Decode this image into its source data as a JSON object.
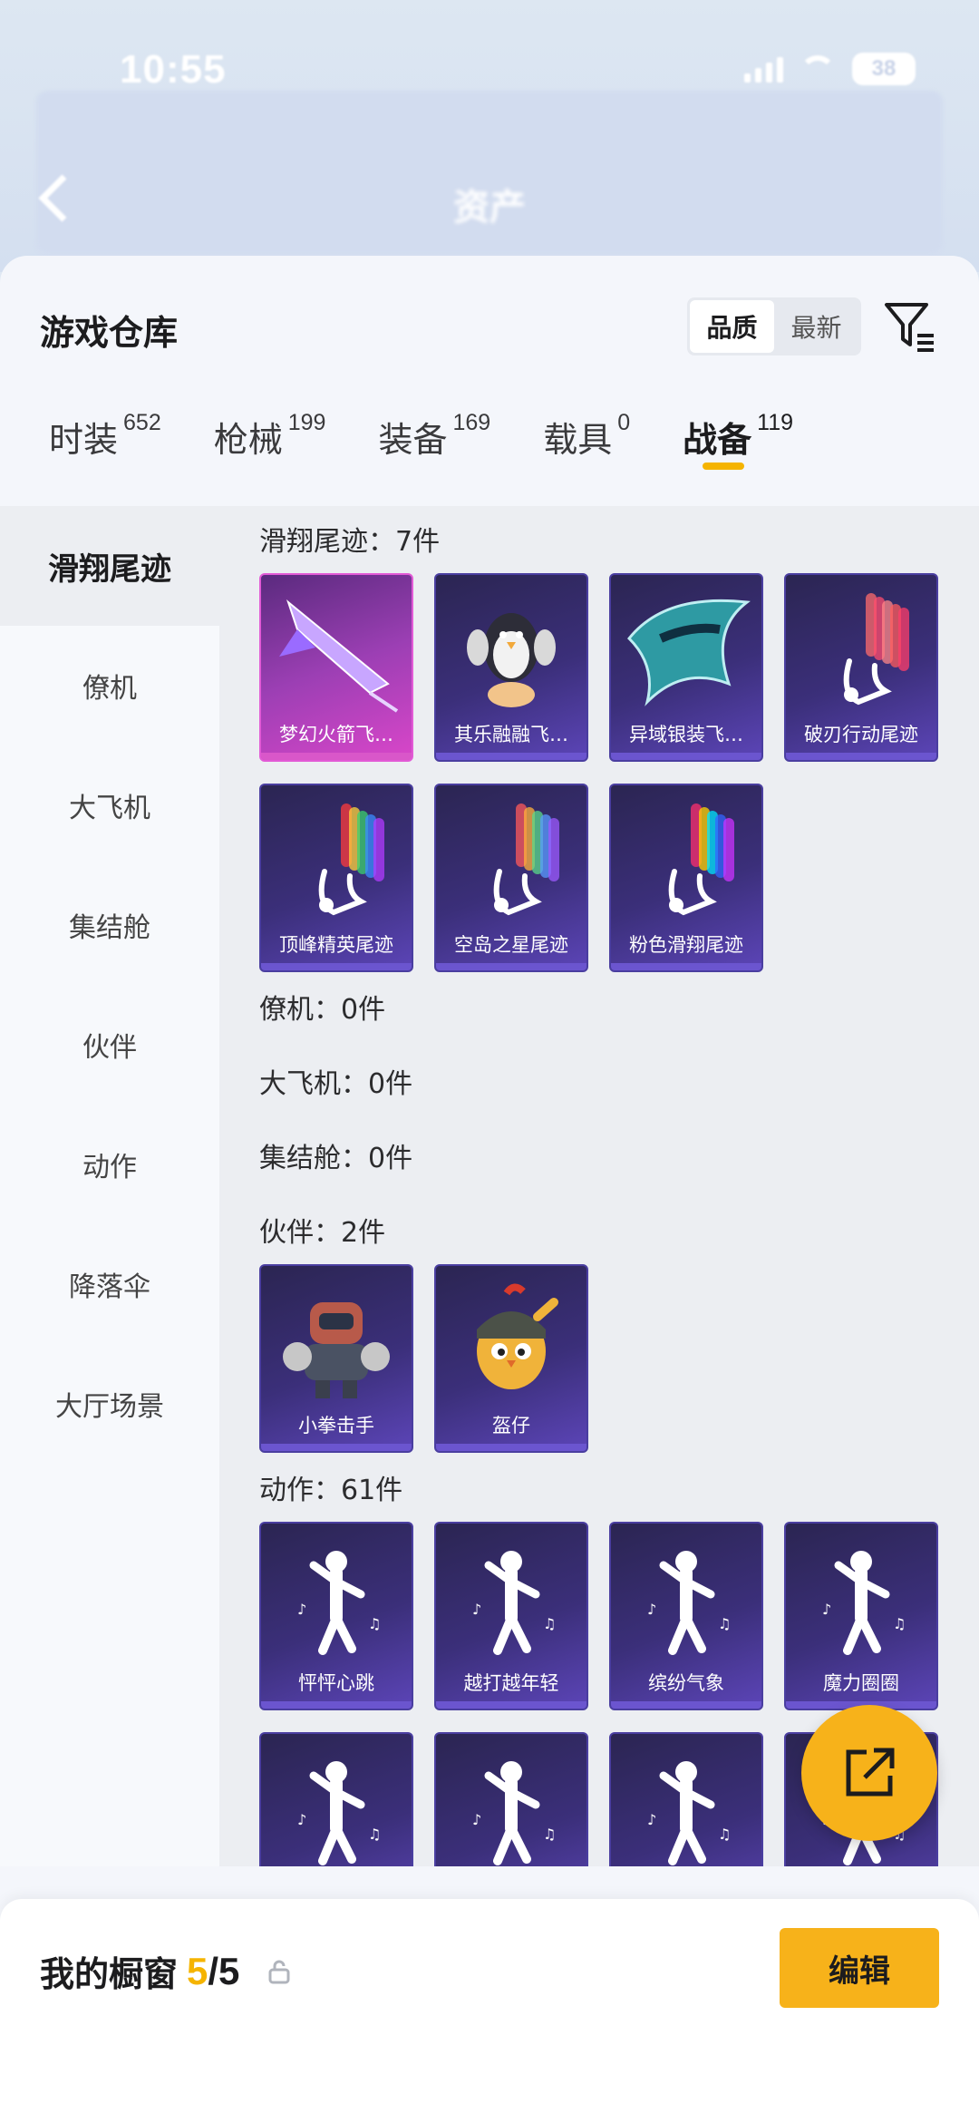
{
  "status_bar": {
    "time": "10:55",
    "battery": "38"
  },
  "app_bar": {
    "title": "资产"
  },
  "panel": {
    "title": "游戏仓库",
    "sort": {
      "options": [
        "品质",
        "最新"
      ],
      "selected": "品质"
    }
  },
  "tabs": [
    {
      "label": "时装",
      "count": "652"
    },
    {
      "label": "枪械",
      "count": "199"
    },
    {
      "label": "装备",
      "count": "169"
    },
    {
      "label": "载具",
      "count": "0"
    },
    {
      "label": "战备",
      "count": "119",
      "active": true
    }
  ],
  "categories": [
    {
      "label": "滑翔尾迹",
      "active": true
    },
    {
      "label": "僚机"
    },
    {
      "label": "大飞机"
    },
    {
      "label": "集结舱"
    },
    {
      "label": "伙伴"
    },
    {
      "label": "动作"
    },
    {
      "label": "降落伞"
    },
    {
      "label": "大厅场景"
    }
  ],
  "sections": [
    {
      "title": "滑翔尾迹：7件",
      "items": [
        {
          "name": "梦幻火箭飞…",
          "icon": "rocket-glider-icon",
          "highlight": true
        },
        {
          "name": "其乐融融飞…",
          "icon": "penguin-glider-icon"
        },
        {
          "name": "异域银装飞…",
          "icon": "winged-glider-icon"
        },
        {
          "name": "破刃行动尾迹",
          "icon": "smoke-trail-icon"
        },
        {
          "name": "顶峰精英尾迹",
          "icon": "smoke-trail-icon"
        },
        {
          "name": "空岛之星尾迹",
          "icon": "smoke-trail-icon"
        },
        {
          "name": "粉色滑翔尾迹",
          "icon": "smoke-trail-icon"
        }
      ]
    },
    {
      "title": "僚机：0件",
      "items": []
    },
    {
      "title": "大飞机：0件",
      "items": []
    },
    {
      "title": "集结舱：0件",
      "items": []
    },
    {
      "title": "伙伴：2件",
      "items": [
        {
          "name": "小拳击手",
          "icon": "boxer-robot-icon"
        },
        {
          "name": "盔仔",
          "icon": "helmet-chick-icon"
        }
      ]
    },
    {
      "title": "动作：61件",
      "items": [
        {
          "name": "怦怦心跳",
          "icon": "dance-pose-icon"
        },
        {
          "name": "越打越年轻",
          "icon": "dance-pose-icon"
        },
        {
          "name": "缤纷气象",
          "icon": "dance-pose-icon"
        },
        {
          "name": "魔力圈圈",
          "icon": "dance-pose-icon"
        },
        {
          "name": "",
          "icon": "dance-pose-icon"
        },
        {
          "name": "",
          "icon": "dance-pose-icon"
        },
        {
          "name": "",
          "icon": "dance-pose-icon"
        },
        {
          "name": "",
          "icon": "dance-pose-icon"
        }
      ]
    }
  ],
  "footer": {
    "showcase_label": "我的橱窗",
    "showcase_current": "5",
    "showcase_sep": "/",
    "showcase_max": "5",
    "edit_label": "编辑"
  },
  "colors": {
    "accent": "#f7b21a",
    "card_bg": "#3b2f7a",
    "card_highlight": "#c43fc1"
  }
}
